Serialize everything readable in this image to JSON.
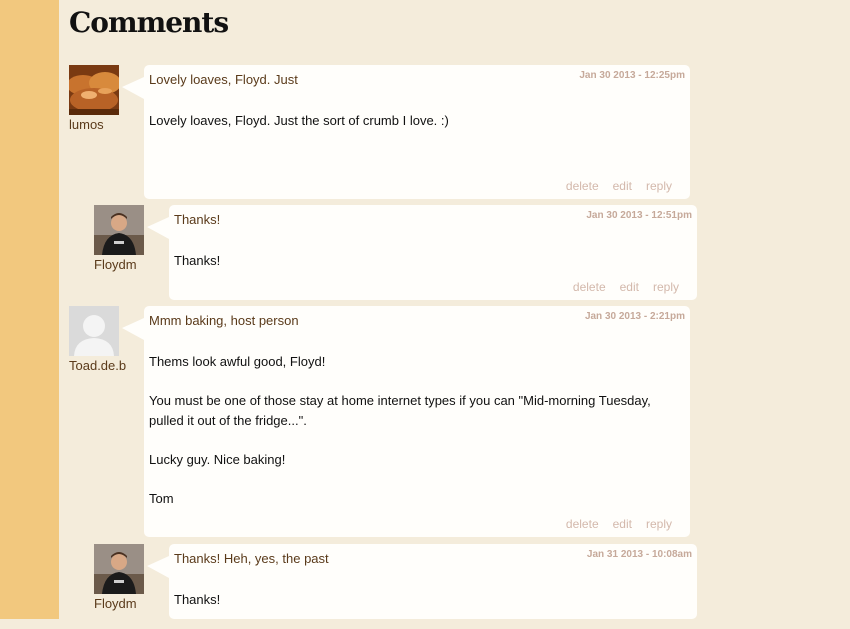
{
  "page": {
    "title": "Comments"
  },
  "actions": {
    "delete": "delete",
    "edit": "edit",
    "reply": "reply"
  },
  "comments": [
    {
      "author": "lumos",
      "avatar_icon": "bread-photo",
      "subject": "Lovely loaves, Floyd. Just",
      "date": "Jan 30 2013 - 12:25pm",
      "paragraphs": [
        "Lovely loaves, Floyd. Just the sort of crumb I love. :)"
      ]
    },
    {
      "author": "Floydm",
      "avatar_icon": "user-photo",
      "subject": "Thanks!",
      "date": "Jan 30 2013 - 12:51pm",
      "paragraphs": [
        "Thanks!"
      ]
    },
    {
      "author": "Toad.de.b",
      "avatar_icon": "default-user-silhouette",
      "subject": "Mmm baking, host person",
      "date": "Jan 30 2013 - 2:21pm",
      "paragraphs": [
        "Thems look awful good, Floyd!",
        "You must be one of those stay at home internet types if you can \"Mid-morning Tuesday, pulled it out of the fridge...\".",
        "Lucky guy.  Nice baking!",
        "Tom"
      ]
    },
    {
      "author": "Floydm",
      "avatar_icon": "user-photo",
      "subject": "Thanks! Heh, yes, the past",
      "date": "Jan 31 2013 - 10:08am",
      "paragraphs": [
        "Thanks!"
      ]
    }
  ]
}
